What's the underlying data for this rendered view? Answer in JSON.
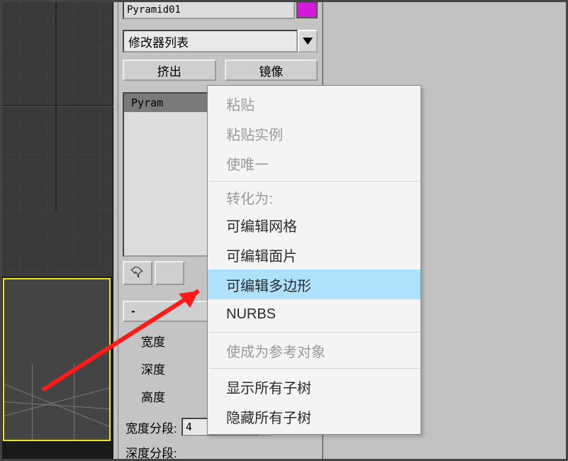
{
  "object_name": "Pyramid01",
  "color_swatch": "#d31ad8",
  "modifier_dropdown": {
    "label": "修改器列表"
  },
  "buttons": {
    "extrude": "挤出",
    "mirror": "镜像"
  },
  "stack": {
    "item0": "Pyram"
  },
  "rollout": {
    "title": "-"
  },
  "params": {
    "width_label": "宽度",
    "depth_label": "深度",
    "height_label": "高度",
    "width_segs_label": "宽度分段:",
    "depth_segs_label": "深度分段:",
    "width_segs_value": "4"
  },
  "context_menu": {
    "paste": "粘贴",
    "paste_instance": "粘贴实例",
    "make_unique": "使唯一",
    "convert_header": "转化为:",
    "editable_mesh": "可编辑网格",
    "editable_patch": "可编辑面片",
    "editable_poly": "可编辑多边形",
    "nurbs": "NURBS",
    "make_reference": "使成为参考对象",
    "show_subtree": "显示所有子树",
    "hide_subtree": "隐藏所有子树"
  }
}
